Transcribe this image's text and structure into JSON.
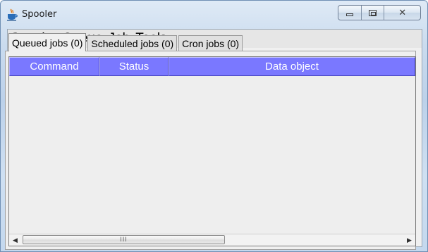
{
  "window": {
    "title": "Spooler",
    "app_icon": "java-cup-icon"
  },
  "caption_buttons": {
    "minimize": "minimize-icon",
    "maximize": "maximize-icon",
    "close": "close-icon"
  },
  "menu": {
    "items": [
      "Spooler",
      "Queue",
      "Job",
      "Tools"
    ]
  },
  "tabs": [
    {
      "label": "Queued jobs (0)",
      "active": true
    },
    {
      "label": "Scheduled jobs (0)",
      "active": false
    },
    {
      "label": "Cron jobs (0)",
      "active": false
    }
  ],
  "table": {
    "columns": [
      "Command",
      "Status",
      "Data object"
    ],
    "rows": [],
    "header_color": "#7a78ff"
  },
  "scrollbar": {
    "grip": "III"
  }
}
